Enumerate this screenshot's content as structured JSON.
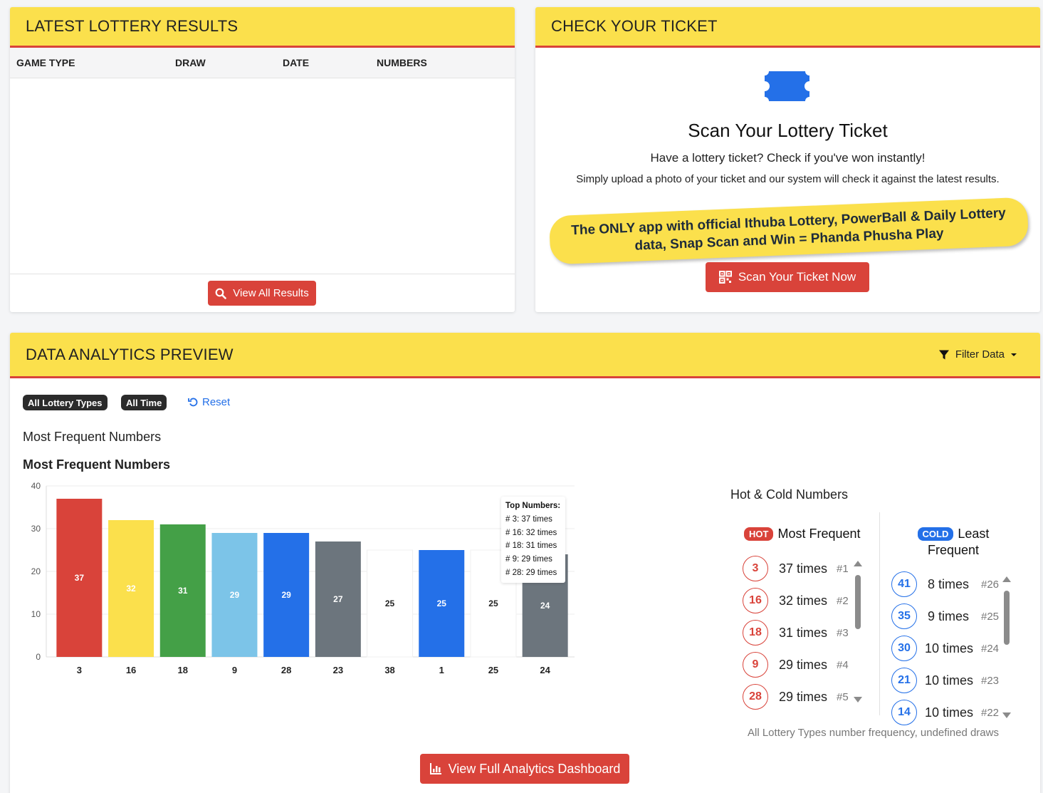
{
  "results": {
    "title": "LATEST LOTTERY RESULTS",
    "columns": [
      "GAME TYPE",
      "DRAW",
      "DATE",
      "NUMBERS"
    ],
    "view_all_label": "View All Results"
  },
  "ticket": {
    "title": "CHECK YOUR TICKET",
    "heading": "Scan Your Lottery Ticket",
    "subheading": "Have a lottery ticket? Check if you've won instantly!",
    "description": "Simply upload a photo of your ticket and our system will check it against the latest results.",
    "promo": "The ONLY app with official Ithuba Lottery, PowerBall & Daily Lottery data, Snap Scan and Win = Phanda Phusha Play",
    "scan_label": "Scan Your Ticket Now",
    "accent_color": "#2470e8"
  },
  "analytics": {
    "title": "DATA ANALYTICS PREVIEW",
    "filter_label": "Filter Data",
    "badges": [
      "All Lottery Types",
      "All Time"
    ],
    "reset_label": "Reset",
    "section_title": "Most Frequent Numbers",
    "chart_title": "Most Frequent Numbers",
    "tooltip": {
      "title": "Top Numbers:",
      "lines": [
        "# 3: 37 times",
        "# 16: 32 times",
        "# 18: 31 times",
        "# 9: 29 times",
        "# 28: 29 times"
      ]
    },
    "hot_cold": {
      "title": "Hot & Cold Numbers",
      "hot_label": "HOT",
      "hot_heading": "Most Frequent",
      "cold_label": "COLD",
      "cold_heading_1": "Least",
      "cold_heading_2": "Frequent",
      "hot": [
        {
          "number": "3",
          "times": "37 times",
          "rank": "#1"
        },
        {
          "number": "16",
          "times": "32 times",
          "rank": "#2"
        },
        {
          "number": "18",
          "times": "31 times",
          "rank": "#3"
        },
        {
          "number": "9",
          "times": "29 times",
          "rank": "#4"
        },
        {
          "number": "28",
          "times": "29 times",
          "rank": "#5"
        }
      ],
      "cold": [
        {
          "number": "41",
          "times": "8 times",
          "rank": "#26"
        },
        {
          "number": "35",
          "times": "9 times",
          "rank": "#25"
        },
        {
          "number": "30",
          "times": "10 times",
          "rank": "#24"
        },
        {
          "number": "21",
          "times": "10 times",
          "rank": "#23"
        },
        {
          "number": "14",
          "times": "10 times",
          "rank": "#22"
        }
      ],
      "footer": "All Lottery Types number frequency, undefined draws"
    },
    "dashboard_label": "View Full Analytics Dashboard"
  },
  "chart_data": {
    "type": "bar",
    "title": "Most Frequent Numbers",
    "categories": [
      "3",
      "16",
      "18",
      "9",
      "28",
      "23",
      "38",
      "1",
      "25",
      "24"
    ],
    "values": [
      37,
      32,
      31,
      29,
      29,
      27,
      25,
      25,
      25,
      24
    ],
    "colors": [
      "#d9433a",
      "#fbe04c",
      "#44a047",
      "#7cc4e8",
      "#2470e8",
      "#6c757d",
      "#ffffff",
      "#2470e8",
      "#ffffff",
      "#6c757d"
    ],
    "ylim": [
      0,
      40
    ],
    "yticks": [
      0,
      10,
      20,
      30,
      40
    ],
    "grid": true,
    "legend": "none"
  }
}
